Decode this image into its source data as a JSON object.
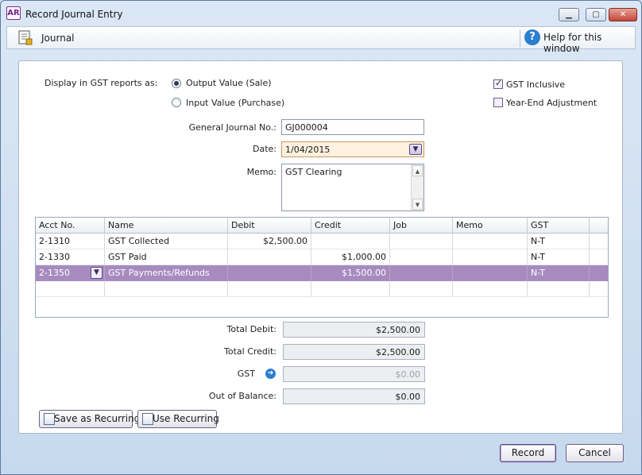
{
  "window": {
    "app_logo": "AR",
    "title": "Record Journal Entry",
    "controls": {
      "minimize": "▁",
      "maximize": "▢",
      "close": "✕"
    }
  },
  "toolbar": {
    "journal_label": "Journal",
    "help_icon_glyph": "?",
    "help_label": "Help for this window"
  },
  "form": {
    "gst_display_label": "Display in GST reports as:",
    "gst_options": [
      {
        "label": "Output Value (Sale)",
        "selected": true
      },
      {
        "label": "Input Value (Purchase)",
        "selected": false
      }
    ],
    "gst_inclusive": {
      "label": "GST Inclusive",
      "checked": true
    },
    "year_end": {
      "label": "Year-End Adjustment",
      "checked": false
    },
    "journal_no": {
      "label": "General Journal No.:",
      "value": "GJ000004"
    },
    "date": {
      "label": "Date:",
      "value": "1/04/2015",
      "dropdown_glyph": "▼"
    },
    "memo": {
      "label": "Memo:",
      "value": "GST Clearing",
      "scroll_up": "▲",
      "scroll_down": "▼"
    }
  },
  "grid": {
    "columns": [
      "Acct No.",
      "Name",
      "Debit",
      "Credit",
      "Job",
      "Memo",
      "GST"
    ],
    "rows": [
      {
        "acct": "2-1310",
        "name": "GST Collected",
        "debit": "$2,500.00",
        "credit": "",
        "job": "",
        "memo": "",
        "gst": "N-T"
      },
      {
        "acct": "2-1330",
        "name": "GST Paid",
        "debit": "",
        "credit": "$1,000.00",
        "job": "",
        "memo": "",
        "gst": "N-T"
      },
      {
        "acct": "2-1350",
        "name": "GST Payments/Refunds",
        "debit": "",
        "credit": "$1,500.00",
        "job": "",
        "memo": "",
        "gst": "N-T"
      }
    ],
    "selected_row": 2,
    "row_dropdown_glyph": "▼"
  },
  "totals": {
    "total_debit": {
      "label": "Total Debit:",
      "value": "$2,500.00"
    },
    "total_credit": {
      "label": "Total Credit:",
      "value": "$2,500.00"
    },
    "gst": {
      "label": "GST",
      "value": "$0.00",
      "arrow_glyph": "➔"
    },
    "out_of_balance": {
      "label": "Out of Balance:",
      "value": "$0.00"
    }
  },
  "buttons": {
    "save_recurring": "Save as Recurring",
    "use_recurring": "Use Recurring",
    "record": "Record",
    "cancel": "Cancel"
  },
  "colors": {
    "selected_row": "#a78bbf",
    "date_field": "#fff1df",
    "accent": "#2c7fd0"
  }
}
